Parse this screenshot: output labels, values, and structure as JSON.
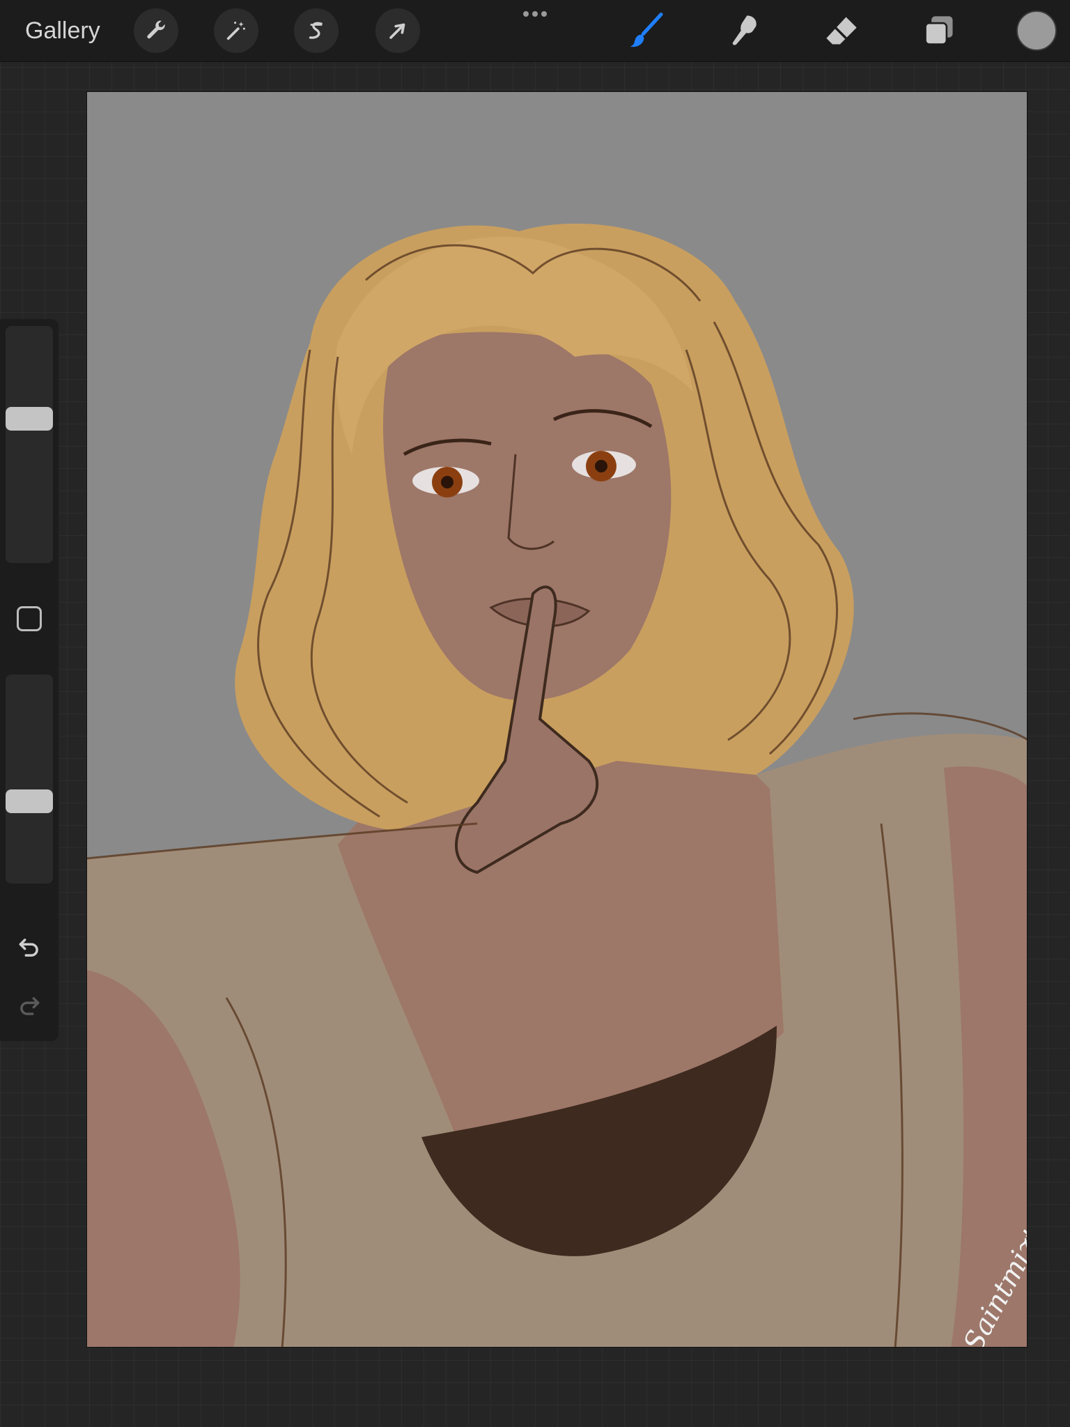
{
  "topbar": {
    "gallery_label": "Gallery",
    "tools_left": [
      {
        "name": "actions",
        "icon": "wrench-icon"
      },
      {
        "name": "adjustments",
        "icon": "magic-wand-icon"
      },
      {
        "name": "selection",
        "icon": "selection-s-icon"
      },
      {
        "name": "transform",
        "icon": "arrow-cursor-icon"
      }
    ],
    "tools_right": [
      {
        "name": "brush",
        "icon": "brush-icon",
        "active": true
      },
      {
        "name": "smudge",
        "icon": "smudge-finger-icon"
      },
      {
        "name": "eraser",
        "icon": "eraser-icon"
      },
      {
        "name": "layers",
        "icon": "layers-icon"
      }
    ],
    "active_tool_color": "#1f7fff",
    "current_color": "#9b9b9b"
  },
  "sidebar": {
    "brush_size_level": 0.62,
    "opacity_level": 0.38,
    "buttons": [
      "modify-button",
      "undo-icon",
      "redo-icon"
    ]
  },
  "canvas": {
    "background_color": "#8a8a8a",
    "signature": "Saintmizta"
  }
}
